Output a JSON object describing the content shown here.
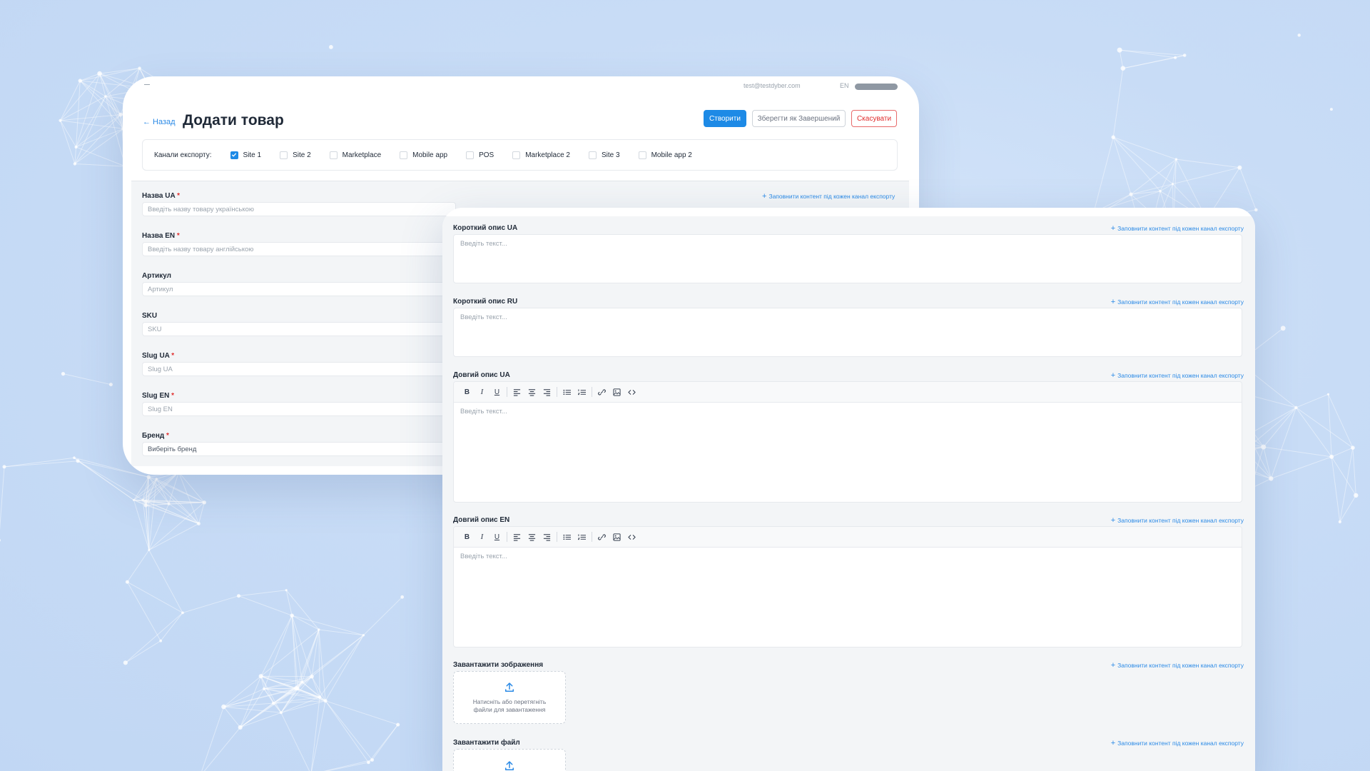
{
  "back_window": {
    "topbar": {
      "email": "test@testdyber.com",
      "lang": "EN"
    },
    "header": {
      "back_label": "← Назад",
      "title": "Додати товар",
      "create_label": "Створити",
      "save_complete_label": "Зберегти як Завершений",
      "cancel_label": "Скасувати"
    },
    "export": {
      "label": "Канали експорту:",
      "channels": [
        {
          "name": "Site 1",
          "checked": true
        },
        {
          "name": "Site 2",
          "checked": false
        },
        {
          "name": "Marketplace",
          "checked": false
        },
        {
          "name": "Mobile app",
          "checked": false
        },
        {
          "name": "POS",
          "checked": false
        },
        {
          "name": "Marketplace 2",
          "checked": false
        },
        {
          "name": "Site 3",
          "checked": false
        },
        {
          "name": "Mobile app 2",
          "checked": false
        }
      ]
    },
    "fill_link": "Заповнити контент під кожен канал експорту",
    "fields": [
      {
        "label": "Назва UA",
        "required": true,
        "placeholder": "Введіть назву товару українською"
      },
      {
        "label": "Назва EN",
        "required": true,
        "placeholder": "Введіть назву товару англійською"
      },
      {
        "label": "Артикул",
        "required": false,
        "placeholder": "Артикул"
      },
      {
        "label": "SKU",
        "required": false,
        "placeholder": "SKU"
      },
      {
        "label": "Slug UA",
        "required": true,
        "placeholder": "Slug UA"
      },
      {
        "label": "Slug EN",
        "required": true,
        "placeholder": "Slug EN"
      },
      {
        "label": "Бренд",
        "required": true,
        "placeholder": "Виберіть бренд"
      }
    ]
  },
  "front_window": {
    "fill_link": "Заповнити контент під кожен канал експорту",
    "short_ua": {
      "label": "Короткий опис UA",
      "placeholder": "Введіть текст..."
    },
    "short_ru": {
      "label": "Короткий опис RU",
      "placeholder": "Введіть текст..."
    },
    "long_ua": {
      "label": "Довгий опис UA",
      "placeholder": "Введіть текст..."
    },
    "long_en": {
      "label": "Довгий опис EN",
      "placeholder": "Введіть текст..."
    },
    "upload_images": {
      "label": "Завантажити зображення",
      "hint": "Натисніть або перетягніть файли для завантаження"
    },
    "upload_file": {
      "label": "Завантажити файл"
    }
  },
  "icons": [
    "check-icon",
    "plus-icon",
    "bold-icon",
    "italic-icon",
    "underline-icon",
    "align-left-icon",
    "align-center-icon",
    "align-right-icon",
    "bullet-list-icon",
    "numbered-list-icon",
    "link-icon",
    "image-icon",
    "code-icon",
    "upload-icon"
  ],
  "colors": {
    "accent": "#1d8ae6",
    "danger": "#e02d2d",
    "background": "#c8dcf6"
  }
}
